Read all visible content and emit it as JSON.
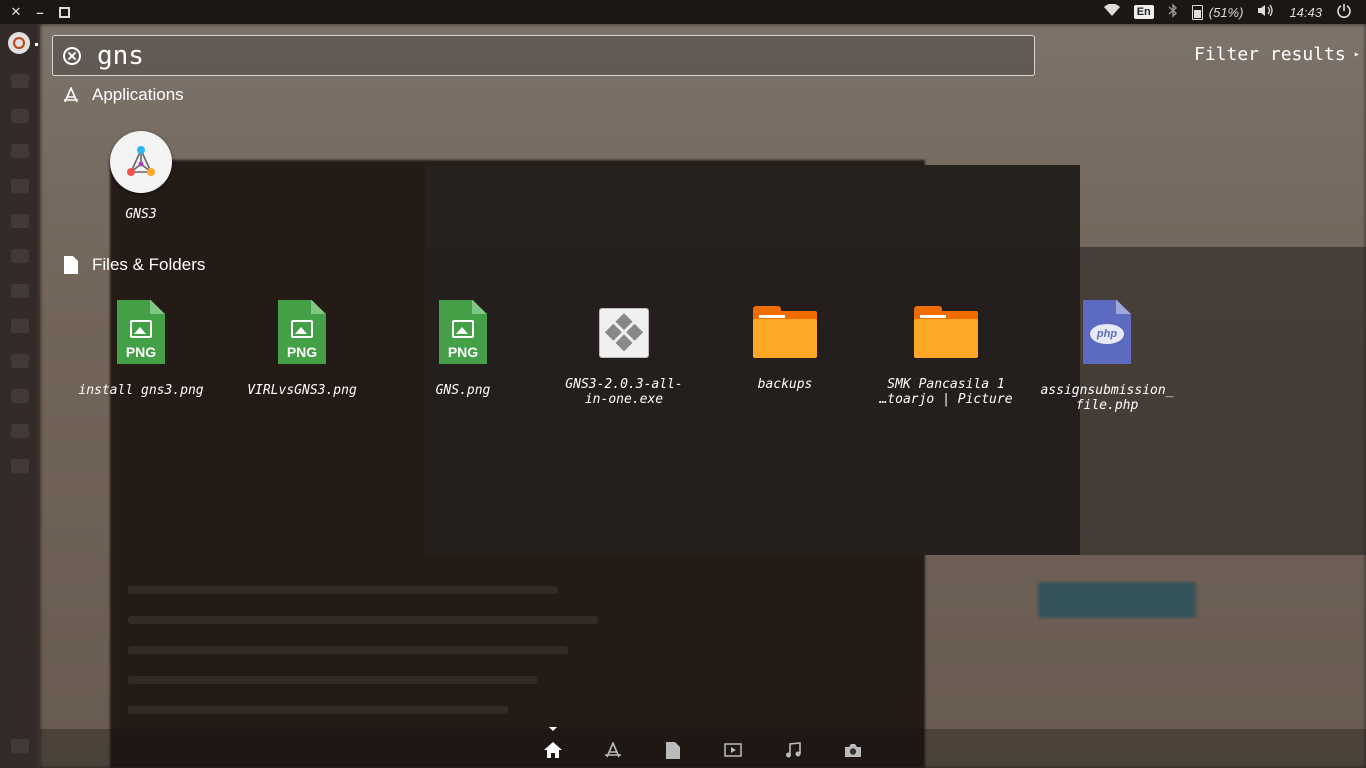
{
  "top_panel": {
    "window_controls": [
      "close-icon",
      "minimize-icon",
      "restore-icon"
    ],
    "keyboard_layout": "En",
    "battery_text": "(51%)",
    "clock": "14:43",
    "icons": [
      "wifi-icon",
      "bluetooth-icon",
      "battery-icon",
      "volume-icon",
      "power-icon"
    ]
  },
  "search": {
    "query": "gns",
    "filter_label": "Filter results"
  },
  "sections": {
    "applications": {
      "title": "Applications",
      "items": [
        {
          "label": "GNS3",
          "icon": "gns3-app-icon"
        }
      ]
    },
    "files": {
      "title": "Files & Folders",
      "items": [
        {
          "label": "install gns3.png",
          "icon": "png-file-icon",
          "badge": "PNG"
        },
        {
          "label": "VIRLvsGNS3.png",
          "icon": "png-file-icon",
          "badge": "PNG"
        },
        {
          "label": "GNS.png",
          "icon": "png-file-icon",
          "badge": "PNG"
        },
        {
          "label_line1": "GNS3-2.0.3-all-",
          "label_line2": "in-one.exe",
          "icon": "exe-file-icon"
        },
        {
          "label": "backups",
          "icon": "folder-icon"
        },
        {
          "label_line1": "SMK Pancasila 1",
          "label_line2": "…toarjo | Picture",
          "icon": "folder-icon"
        },
        {
          "label_line1": "assignsubmission_",
          "label_line2": "file.php",
          "icon": "php-file-icon",
          "badge": "php"
        }
      ]
    }
  },
  "lenses": [
    "home-lens-icon",
    "applications-lens-icon",
    "files-lens-icon",
    "video-lens-icon",
    "music-lens-icon",
    "photos-lens-icon"
  ],
  "colors": {
    "png": "#43a047",
    "folder": "#ffa726",
    "php": "#5c6bc0",
    "ubuntu_orange": "#e95420"
  }
}
